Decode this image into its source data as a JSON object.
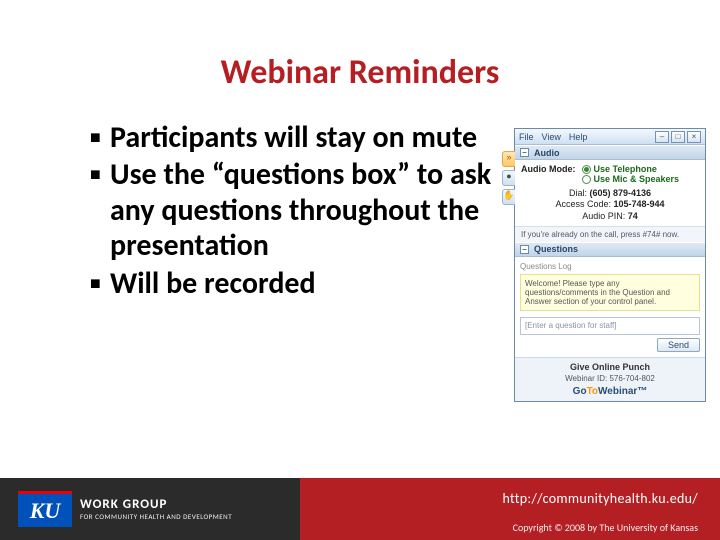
{
  "slide": {
    "title": "Webinar Reminders",
    "bullets": [
      "Participants will stay on mute",
      "Use the “questions box” to ask any questions throughout the presentation",
      " Will be recorded"
    ]
  },
  "footer": {
    "logo_mark": "KU",
    "logo_line1": "WORK GROUP",
    "logo_line2": "FOR COMMUNITY HEALTH AND DEVELOPMENT",
    "url": "http://communityhealth.ku.edu/",
    "copyright": "Copyright © 2008 by The University of Kansas"
  },
  "gtw": {
    "menu": {
      "file": "File",
      "view": "View",
      "help": "Help"
    },
    "win": {
      "min": "–",
      "max": "□",
      "close": "×"
    },
    "side": {
      "arrows": "»",
      "mic": "●",
      "hand": "✋"
    },
    "audio": {
      "header": "Audio",
      "mode_label": "Audio Mode:",
      "opt_phone": "Use Telephone",
      "opt_mic": "Use Mic & Speakers",
      "dial_label": "Dial:",
      "dial_value": "(605) 879-4136",
      "code_label": "Access Code:",
      "code_value": "105-748-944",
      "pin_label": "Audio PIN:",
      "pin_value": "74",
      "hint": "If you're already on the call, press #74# now."
    },
    "questions": {
      "header": "Questions",
      "log_label": "Questions Log",
      "welcome_msg": "Welcome! Please type any questions/comments in the Question and Answer section of your control panel.",
      "input_placeholder": "[Enter a question for staff]",
      "send_label": "Send"
    },
    "foot": {
      "punch": "Give Online Punch",
      "webinar_id_label": "Webinar ID:",
      "webinar_id_value": "576-704-802",
      "brand_go": "Go",
      "brand_to": "To",
      "brand_webinar": "Webinar™"
    }
  }
}
